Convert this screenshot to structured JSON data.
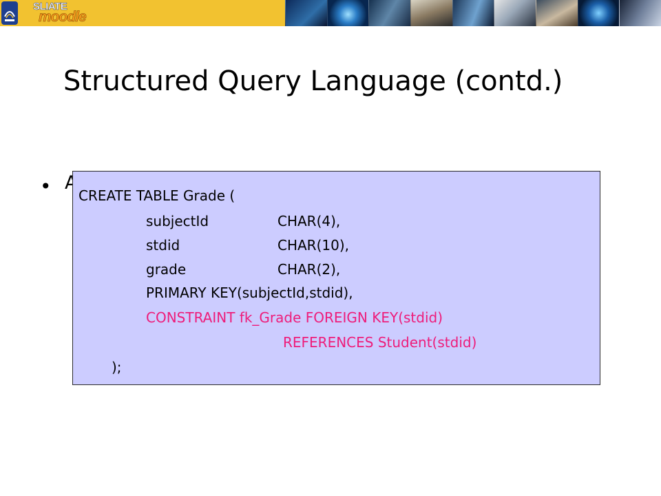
{
  "banner": {
    "brand_top": "SLIATE",
    "brand_bottom": "moodle",
    "photos": [
      "technology-photo",
      "globe-photo",
      "keyboard-photo",
      "student-photo",
      "monitor-photo",
      "hands-photo",
      "classroom-photo",
      "earth-photo",
      "eye-photo"
    ]
  },
  "slide": {
    "title": "Structured Query Language (contd.)",
    "bullet_marker": "•",
    "bullet_visible_text": "A"
  },
  "code": {
    "line_create": "CREATE TABLE Grade (",
    "columns": [
      {
        "name": "subjectId",
        "type": "CHAR(4),"
      },
      {
        "name": "stdid",
        "type": "CHAR(10),"
      },
      {
        "name": "grade",
        "type": "CHAR(2),"
      }
    ],
    "line_primary_key": "PRIMARY KEY(subjectId,stdid),",
    "line_constraint": "CONSTRAINT fk_Grade  FOREIGN KEY(stdid)",
    "line_references": "REFERENCES Student(stdid)",
    "line_close": ");"
  },
  "colors": {
    "code_background": "#ccccff",
    "foreign_key_text": "#ee1c7a",
    "banner_logo_block": "#f2c230"
  }
}
